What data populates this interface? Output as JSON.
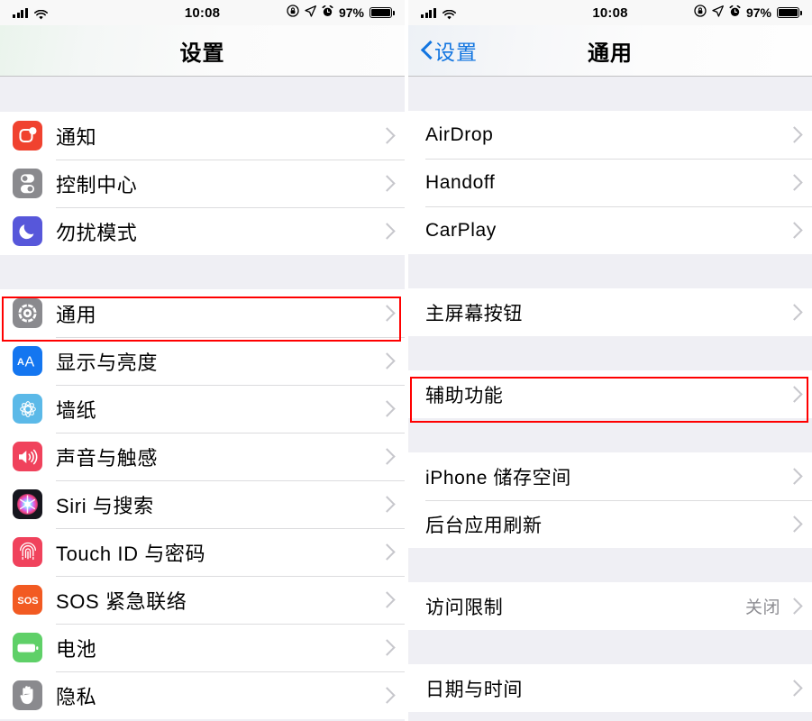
{
  "status_bar": {
    "time": "10:08",
    "battery_percent": "97%",
    "icons": [
      "cellular-signal-icon",
      "wifi-icon",
      "rotation-lock-icon",
      "location-arrow-icon",
      "alarm-clock-icon",
      "battery-icon"
    ]
  },
  "left_panel": {
    "title": "设置",
    "sections": [
      {
        "rows": [
          {
            "label": "通知",
            "icon": "notifications-icon",
            "value": ""
          },
          {
            "label": "控制中心",
            "icon": "control-center-icon",
            "value": ""
          },
          {
            "label": "勿扰模式",
            "icon": "do-not-disturb-icon",
            "value": ""
          }
        ]
      },
      {
        "rows": [
          {
            "label": "通用",
            "icon": "general-gear-icon",
            "value": "",
            "highlighted": true
          },
          {
            "label": "显示与亮度",
            "icon": "display-brightness-icon",
            "value": ""
          },
          {
            "label": "墙纸",
            "icon": "wallpaper-icon",
            "value": ""
          },
          {
            "label": "声音与触感",
            "icon": "sounds-haptics-icon",
            "value": ""
          },
          {
            "label": "Siri 与搜索",
            "icon": "siri-search-icon",
            "value": ""
          },
          {
            "label": "Touch ID 与密码",
            "icon": "touch-id-icon",
            "value": ""
          },
          {
            "label": "SOS 紧急联络",
            "icon": "emergency-sos-icon",
            "value": ""
          },
          {
            "label": "电池",
            "icon": "battery-settings-icon",
            "value": ""
          },
          {
            "label": "隐私",
            "icon": "privacy-hand-icon",
            "value": ""
          }
        ]
      }
    ]
  },
  "right_panel": {
    "title": "通用",
    "back_label": "设置",
    "sections": [
      {
        "rows": [
          {
            "label": "AirDrop",
            "value": ""
          },
          {
            "label": "Handoff",
            "value": ""
          },
          {
            "label": "CarPlay",
            "value": ""
          }
        ]
      },
      {
        "rows": [
          {
            "label": "主屏幕按钮",
            "value": ""
          }
        ]
      },
      {
        "rows": [
          {
            "label": "辅助功能",
            "value": "",
            "highlighted": true
          }
        ]
      },
      {
        "rows": [
          {
            "label": "iPhone 储存空间",
            "value": ""
          },
          {
            "label": "后台应用刷新",
            "value": ""
          }
        ]
      },
      {
        "rows": [
          {
            "label": "访问限制",
            "value": "关闭"
          }
        ]
      },
      {
        "rows": [
          {
            "label": "日期与时间",
            "value": ""
          }
        ]
      }
    ]
  },
  "colors": {
    "highlight": "#FF0000",
    "accent_blue": "#1275E0",
    "group_background": "#EFEFF4",
    "row_background": "#FFFFFF",
    "separator": "#DCDCDE",
    "secondary_text": "#8E8E93"
  }
}
